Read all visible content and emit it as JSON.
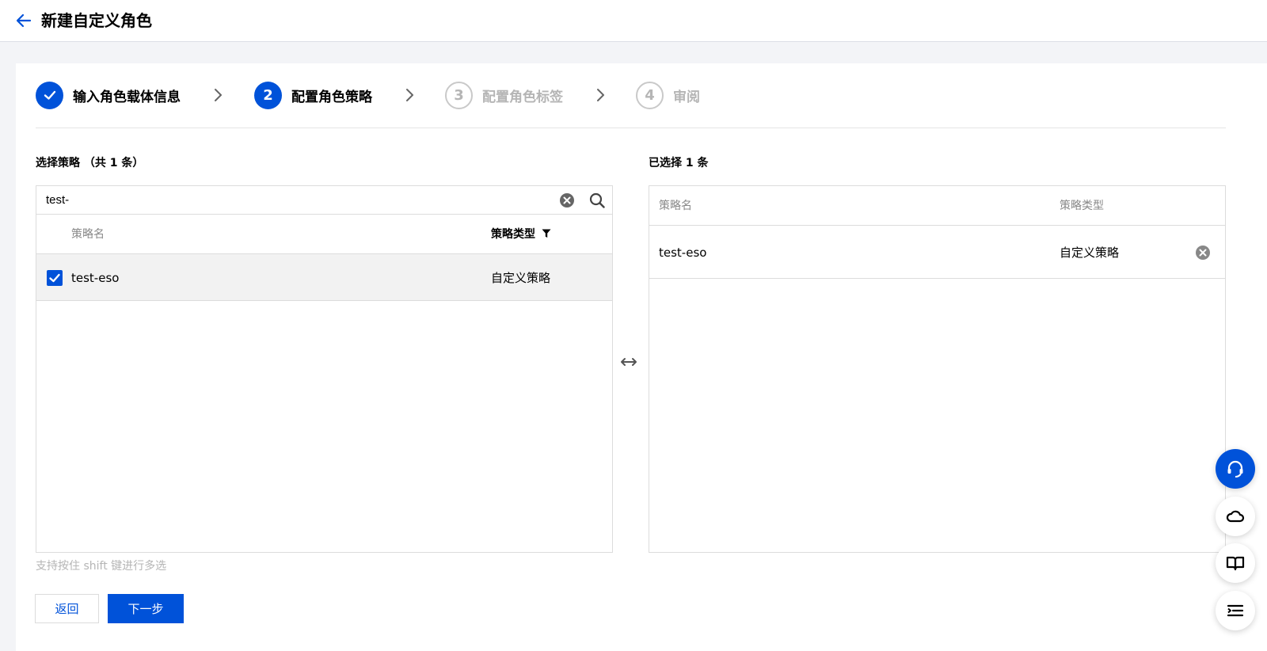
{
  "header": {
    "title": "新建自定义角色"
  },
  "steps": [
    {
      "number": "",
      "label": "输入角色载体信息",
      "state": "done"
    },
    {
      "number": "2",
      "label": "配置角色策略",
      "state": "active"
    },
    {
      "number": "3",
      "label": "配置角色标签",
      "state": "pending"
    },
    {
      "number": "4",
      "label": "审阅",
      "state": "pending"
    }
  ],
  "left": {
    "title": "选择策略 （共 1 条）",
    "search": {
      "value": "test-"
    },
    "columns": {
      "name": "策略名",
      "type": "策略类型"
    },
    "rows": [
      {
        "name": "test-eso",
        "type": "自定义策略",
        "checked": true
      }
    ]
  },
  "right": {
    "title": "已选择 1 条",
    "columns": {
      "name": "策略名",
      "type": "策略类型"
    },
    "rows": [
      {
        "name": "test-eso",
        "type": "自定义策略"
      }
    ]
  },
  "hint": "支持按住 shift 键进行多选",
  "buttons": {
    "back": "返回",
    "next": "下一步"
  },
  "colors": {
    "primary": "#0052d9",
    "pending": "#b5b5b5",
    "selected_row": "#f2f2f2"
  }
}
